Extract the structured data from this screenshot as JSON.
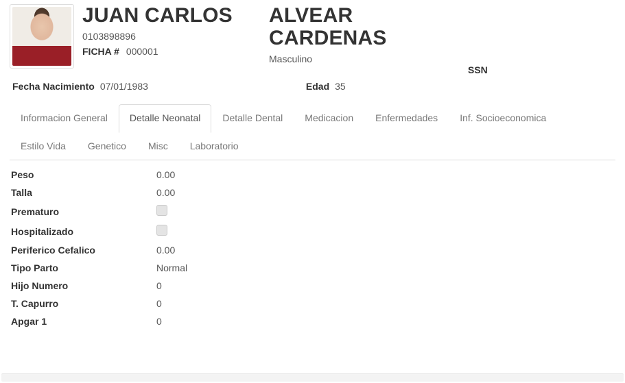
{
  "header": {
    "first_names": "JUAN CARLOS",
    "last_names": "ALVEAR CARDENAS",
    "id_number": "0103898896",
    "ficha_label": "FICHA #",
    "ficha_value": "000001",
    "gender": "Masculino",
    "ssn_label": "SSN",
    "dob_label": "Fecha Nacimiento",
    "dob_value": "07/01/1983",
    "age_label": "Edad",
    "age_value": "35"
  },
  "tabs": {
    "t0": "Informacion General",
    "t1": "Detalle Neonatal",
    "t2": "Detalle Dental",
    "t3": "Medicacion",
    "t4": "Enfermedades",
    "t5": "Inf. Socioeconomica",
    "t6": "Estilo Vida",
    "t7": "Genetico",
    "t8": "Misc",
    "t9": "Laboratorio"
  },
  "details": {
    "rows": [
      {
        "label": "Peso",
        "value": "0.00",
        "type": "text"
      },
      {
        "label": "Talla",
        "value": "0.00",
        "type": "text"
      },
      {
        "label": "Prematuro",
        "value": false,
        "type": "check"
      },
      {
        "label": "Hospitalizado",
        "value": false,
        "type": "check"
      },
      {
        "label": "Periferico Cefalico",
        "value": "0.00",
        "type": "text"
      },
      {
        "label": "Tipo Parto",
        "value": "Normal",
        "type": "text"
      },
      {
        "label": "Hijo Numero",
        "value": "0",
        "type": "text"
      },
      {
        "label": "T. Capurro",
        "value": "0",
        "type": "text"
      },
      {
        "label": "Apgar 1",
        "value": "0",
        "type": "text"
      }
    ]
  }
}
